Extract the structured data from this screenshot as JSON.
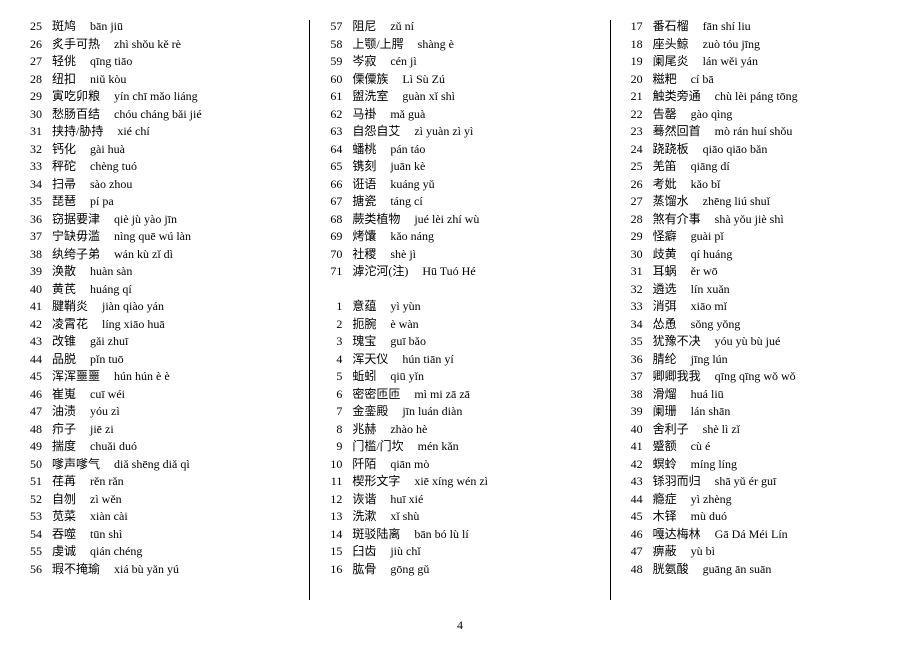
{
  "page_number": "4",
  "columns": [
    {
      "entries": [
        {
          "n": "25",
          "hz": "斑鸠",
          "py": "bān jiū"
        },
        {
          "n": "26",
          "hz": "炙手可热",
          "py": "zhì shǒu kě rè"
        },
        {
          "n": "27",
          "hz": "轻佻",
          "py": "qīng tiāo"
        },
        {
          "n": "28",
          "hz": "纽扣",
          "py": "niǔ kòu"
        },
        {
          "n": "29",
          "hz": "寅吃卯粮",
          "py": "yín chī mǎo liáng"
        },
        {
          "n": "30",
          "hz": "愁肠百结",
          "py": "chóu cháng bǎi jié"
        },
        {
          "n": "31",
          "hz": "挟持/胁持",
          "py": "xié chí"
        },
        {
          "n": "32",
          "hz": "钙化",
          "py": "gài huà"
        },
        {
          "n": "33",
          "hz": "秤砣",
          "py": "chèng tuó"
        },
        {
          "n": "34",
          "hz": "扫帚",
          "py": "sào zhou"
        },
        {
          "n": "35",
          "hz": "琵琶",
          "py": "pí pa"
        },
        {
          "n": "36",
          "hz": "窃据要津",
          "py": "qiè jù yào jīn"
        },
        {
          "n": "37",
          "hz": "宁缺毋滥",
          "py": "nìng quē wú làn"
        },
        {
          "n": "38",
          "hz": "纨绔子弟",
          "py": "wán kù zǐ dì"
        },
        {
          "n": "39",
          "hz": "涣散",
          "py": "huàn sàn"
        },
        {
          "n": "40",
          "hz": "黄芪",
          "py": "huáng qí"
        },
        {
          "n": "41",
          "hz": "腱鞘炎",
          "py": "jiàn qiào yán"
        },
        {
          "n": "42",
          "hz": "凌霄花",
          "py": "líng xiāo huā"
        },
        {
          "n": "43",
          "hz": "改锥",
          "py": "gǎi zhuī"
        },
        {
          "n": "44",
          "hz": "品脱",
          "py": "pǐn tuō"
        },
        {
          "n": "45",
          "hz": "浑浑噩噩",
          "py": "hún hún è è"
        },
        {
          "n": "46",
          "hz": "崔嵬",
          "py": "cuī wéi"
        },
        {
          "n": "47",
          "hz": "油渍",
          "py": "yóu zì"
        },
        {
          "n": "48",
          "hz": "疖子",
          "py": "jiē zi"
        },
        {
          "n": "49",
          "hz": "揣度",
          "py": "chuǎi duó"
        },
        {
          "n": "50",
          "hz": "嗲声嗲气",
          "py": "diǎ shēng diǎ qì"
        },
        {
          "n": "51",
          "hz": "荏苒",
          "py": "rěn rǎn"
        },
        {
          "n": "52",
          "hz": "自刎",
          "py": "zì wěn"
        },
        {
          "n": "53",
          "hz": "苋菜",
          "py": "xiàn cài"
        },
        {
          "n": "54",
          "hz": "吞噬",
          "py": "tūn shì"
        },
        {
          "n": "55",
          "hz": "虔诚",
          "py": "qián chéng"
        },
        {
          "n": "56",
          "hz": "瑕不掩瑜",
          "py": "xiá bù yǎn yú"
        }
      ]
    },
    {
      "entries_top": [
        {
          "n": "57",
          "hz": "阻尼",
          "py": "zǔ ní"
        },
        {
          "n": "58",
          "hz": "上颚/上腭",
          "py": "shàng è"
        },
        {
          "n": "59",
          "hz": "岑寂",
          "py": "cén jì"
        },
        {
          "n": "60",
          "hz": "傈僳族",
          "py": "Lì Sù Zú"
        },
        {
          "n": "61",
          "hz": "盥洗室",
          "py": "guàn xǐ shì"
        },
        {
          "n": "62",
          "hz": "马褂",
          "py": "mǎ guà"
        },
        {
          "n": "63",
          "hz": "自怨自艾",
          "py": "zì yuàn zì yì"
        },
        {
          "n": "64",
          "hz": "蟠桃",
          "py": "pán táo"
        },
        {
          "n": "65",
          "hz": "镌刻",
          "py": "juān kè"
        },
        {
          "n": "66",
          "hz": "诳语",
          "py": "kuáng yǔ"
        },
        {
          "n": "67",
          "hz": "搪瓷",
          "py": "táng cí"
        },
        {
          "n": "68",
          "hz": "蕨类植物",
          "py": "jué lèi zhí wù"
        },
        {
          "n": "69",
          "hz": "烤馕",
          "py": "kǎo náng"
        },
        {
          "n": "70",
          "hz": "社稷",
          "py": "shè jì"
        },
        {
          "n": "71",
          "hz": "滹沱河(注)",
          "py": "Hū Tuó Hé"
        }
      ],
      "entries_bottom": [
        {
          "n": "1",
          "hz": "意蕴",
          "py": "yì yùn"
        },
        {
          "n": "2",
          "hz": "扼腕",
          "py": "è wàn"
        },
        {
          "n": "3",
          "hz": "瑰宝",
          "py": "guī bǎo"
        },
        {
          "n": "4",
          "hz": "浑天仪",
          "py": "hún tiān yí"
        },
        {
          "n": "5",
          "hz": "蚯蚓",
          "py": "qiū yǐn"
        },
        {
          "n": "6",
          "hz": "密密匝匝",
          "py": "mì mi zā zā"
        },
        {
          "n": "7",
          "hz": "金銮殿",
          "py": "jīn luán diàn"
        },
        {
          "n": "8",
          "hz": "兆赫",
          "py": "zhào hè"
        },
        {
          "n": "9",
          "hz": "门槛/门坎",
          "py": "mén kǎn"
        },
        {
          "n": "10",
          "hz": "阡陌",
          "py": "qiān mò"
        },
        {
          "n": "11",
          "hz": "楔形文字",
          "py": "xiē xíng wén zì"
        },
        {
          "n": "12",
          "hz": "诙谐",
          "py": "huī xié"
        },
        {
          "n": "13",
          "hz": "洗漱",
          "py": "xǐ shù"
        },
        {
          "n": "14",
          "hz": "斑驳陆离",
          "py": "bān bó lù lí"
        },
        {
          "n": "15",
          "hz": "臼齿",
          "py": "jiù chǐ"
        },
        {
          "n": "16",
          "hz": "肱骨",
          "py": "gōng gǔ"
        }
      ]
    },
    {
      "entries": [
        {
          "n": "17",
          "hz": "番石榴",
          "py": "fān shí liu"
        },
        {
          "n": "18",
          "hz": "座头鲸",
          "py": "zuò tóu jīng"
        },
        {
          "n": "19",
          "hz": "阑尾炎",
          "py": "lán wěi yán"
        },
        {
          "n": "20",
          "hz": "糍粑",
          "py": "cí bā"
        },
        {
          "n": "21",
          "hz": "触类旁通",
          "py": "chù lèi páng tōng"
        },
        {
          "n": "22",
          "hz": "告罄",
          "py": "gào qìng"
        },
        {
          "n": "23",
          "hz": "蓦然回首",
          "py": "mò rán huí shǒu"
        },
        {
          "n": "24",
          "hz": "跷跷板",
          "py": "qiāo qiāo bǎn"
        },
        {
          "n": "25",
          "hz": "羌笛",
          "py": "qiāng dí"
        },
        {
          "n": "26",
          "hz": "考妣",
          "py": "kǎo bǐ"
        },
        {
          "n": "27",
          "hz": "蒸馏水",
          "py": "zhēng liú shuǐ"
        },
        {
          "n": "28",
          "hz": "煞有介事",
          "py": "shà yǒu jiè shì"
        },
        {
          "n": "29",
          "hz": "怪癖",
          "py": "guài pǐ"
        },
        {
          "n": "30",
          "hz": "歧黄",
          "py": "qí huáng"
        },
        {
          "n": "31",
          "hz": "耳蜗",
          "py": "ěr wō"
        },
        {
          "n": "32",
          "hz": "遴选",
          "py": "lín xuǎn"
        },
        {
          "n": "33",
          "hz": "消弭",
          "py": "xiāo mǐ"
        },
        {
          "n": "34",
          "hz": "怂恿",
          "py": "sǒng yǒng"
        },
        {
          "n": "35",
          "hz": "犹豫不决",
          "py": "yóu yù bù jué"
        },
        {
          "n": "36",
          "hz": "腈纶",
          "py": "jīng lún"
        },
        {
          "n": "37",
          "hz": "卿卿我我",
          "py": "qīng qīng wǒ wǒ"
        },
        {
          "n": "38",
          "hz": "滑熘",
          "py": "huá liū"
        },
        {
          "n": "39",
          "hz": "阑珊",
          "py": "lán shān"
        },
        {
          "n": "40",
          "hz": "舍利子",
          "py": "shè lì zǐ"
        },
        {
          "n": "41",
          "hz": "蹙额",
          "py": "cù é"
        },
        {
          "n": "42",
          "hz": "螟蛉",
          "py": "míng líng"
        },
        {
          "n": "43",
          "hz": "铩羽而归",
          "py": "shā yǔ ér guī"
        },
        {
          "n": "44",
          "hz": "瘾症",
          "py": "yì zhèng"
        },
        {
          "n": "45",
          "hz": "木铎",
          "py": "mù duó"
        },
        {
          "n": "46",
          "hz": "嘎达梅林",
          "py": "Gā Dá Méi Lín"
        },
        {
          "n": "47",
          "hz": "痹蔽",
          "py": "yù bì"
        },
        {
          "n": "48",
          "hz": "胱氨酸",
          "py": "guāng ān suān"
        }
      ]
    }
  ]
}
